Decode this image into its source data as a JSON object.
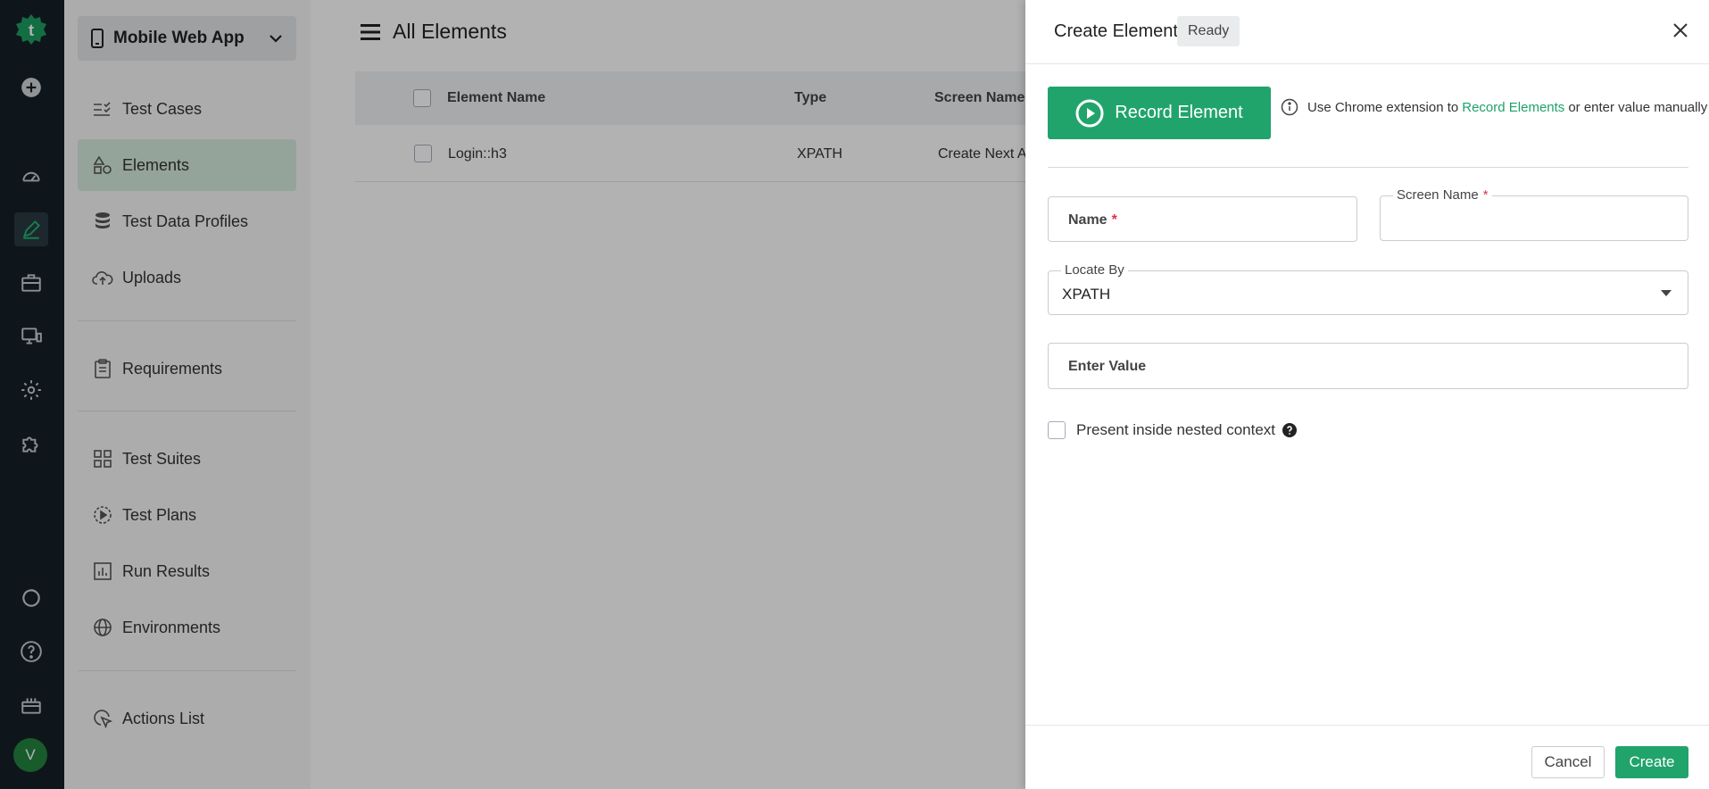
{
  "rail": {
    "avatar_letter": "V",
    "icons": [
      "logo-icon",
      "plus-circle-icon",
      "dashboard-icon",
      "edit-pen-icon",
      "briefcase-icon",
      "monitor-icon",
      "gear-icon",
      "puzzle-icon",
      "refresh-icon",
      "help-icon",
      "gift-icon"
    ]
  },
  "nav": {
    "project": "Mobile Web App",
    "items": [
      {
        "label": "Test Cases"
      },
      {
        "label": "Elements"
      },
      {
        "label": "Test Data Profiles"
      },
      {
        "label": "Uploads"
      },
      {
        "label": "Requirements"
      },
      {
        "label": "Test Suites"
      },
      {
        "label": "Test Plans"
      },
      {
        "label": "Run Results"
      },
      {
        "label": "Environments"
      },
      {
        "label": "Actions List"
      }
    ]
  },
  "main": {
    "title": "All Elements",
    "columns": [
      "Element Name",
      "Type",
      "Screen Name"
    ],
    "rows": [
      {
        "name": "Login::h3",
        "type": "XPATH",
        "screen": "Create Next App"
      }
    ]
  },
  "drawer": {
    "title": "Create Element",
    "badge": "Ready",
    "record_label": "Record Element",
    "hint_prefix": "Use Chrome extension to",
    "hint_link": "Record Elements",
    "hint_suffix": "or enter value manually",
    "name_placeholder": "Name",
    "screen_name_label": "Screen Name",
    "locate_by_label": "Locate By",
    "locate_by_value": "XPATH",
    "value_placeholder": "Enter Value",
    "nested_label": "Present inside nested context",
    "required_mark": "*",
    "cancel_label": "Cancel",
    "create_label": "Create"
  },
  "colors": {
    "accent": "#20a46b",
    "rail_bg": "#162028",
    "active_nav": "#d6ebdf",
    "required": "#e0334a"
  }
}
